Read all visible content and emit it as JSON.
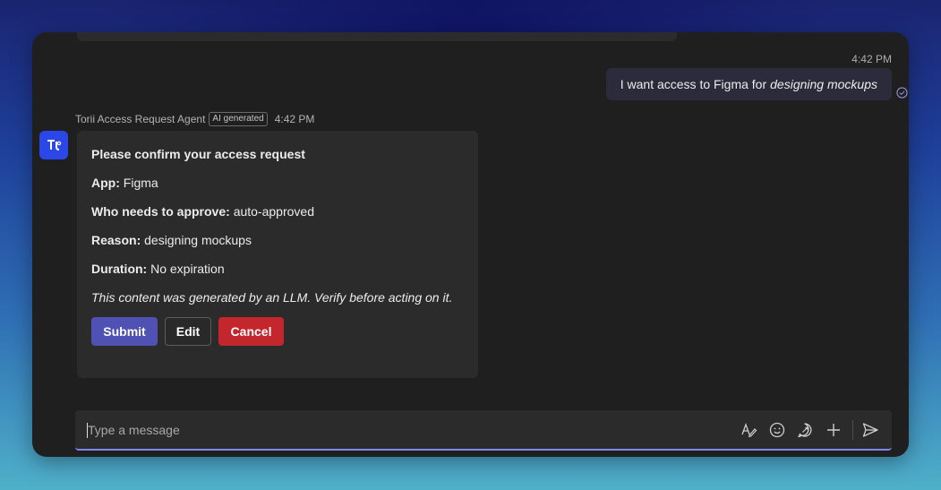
{
  "chat": {
    "outgoing": {
      "time": "4:42 PM",
      "text_prefix": "I want access to Figma for",
      "text_emphasis": "designing mockups"
    },
    "agent": {
      "name": "Torii Access Request Agent",
      "badge": "AI generated",
      "time": "4:42 PM"
    },
    "card": {
      "title": "Please confirm your access request",
      "fields": [
        {
          "label": "App:",
          "value": "Figma"
        },
        {
          "label": "Who needs to approve:",
          "value": "auto-approved"
        },
        {
          "label": "Reason:",
          "value": "designing mockups"
        },
        {
          "label": "Duration:",
          "value": "No expiration"
        }
      ],
      "disclaimer": "This content was generated by an LLM. Verify before acting on it.",
      "actions": {
        "submit": "Submit",
        "edit": "Edit",
        "cancel": "Cancel"
      }
    }
  },
  "composer": {
    "placeholder": "Type a message",
    "icons": [
      "format-icon",
      "emoji-icon",
      "loop-icon",
      "add-icon",
      "send-icon"
    ]
  },
  "colors": {
    "submit": "#4f52b2",
    "cancel": "#c4262e",
    "avatar": "#2c47e8",
    "composer_focus": "#7f85f5"
  }
}
